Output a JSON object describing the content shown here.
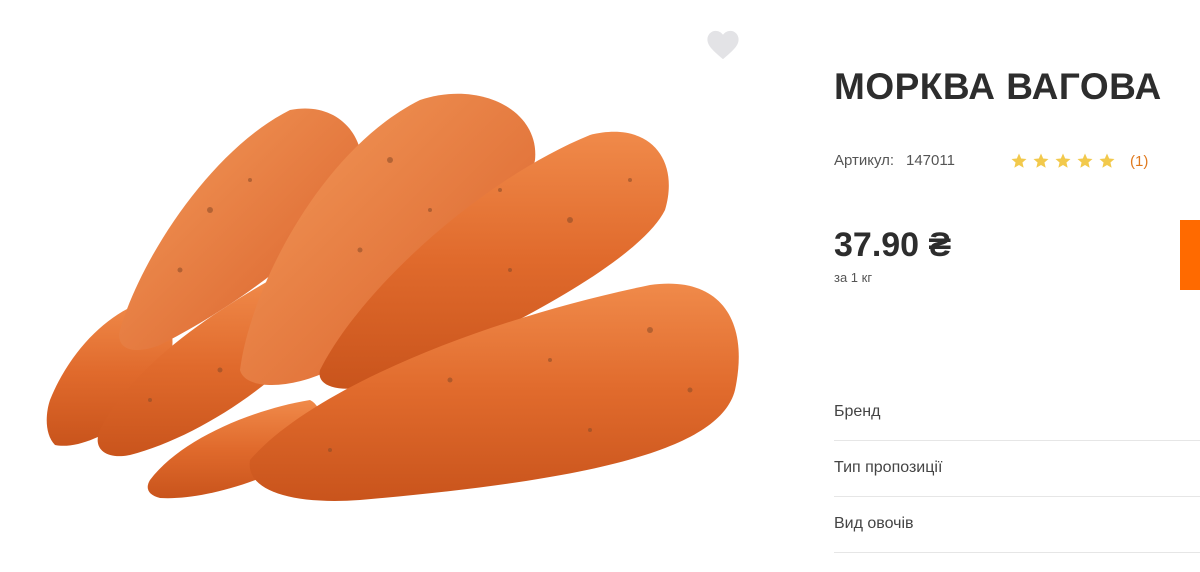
{
  "product": {
    "title": "МОРКВА ВАГОВА",
    "sku_label": "Артикул:",
    "sku_value": "147011",
    "rating": {
      "stars": 5,
      "max_stars": 5,
      "count_text": "(1)",
      "star_color": "#f2c94c"
    },
    "price": "37.90 ₴",
    "unit": "за 1 кг",
    "accent_color": "#ff6a00",
    "favorite_icon": "heart-icon"
  },
  "attributes": [
    {
      "label": "Бренд"
    },
    {
      "label": "Тип пропозиції"
    },
    {
      "label": "Вид овочів"
    }
  ]
}
